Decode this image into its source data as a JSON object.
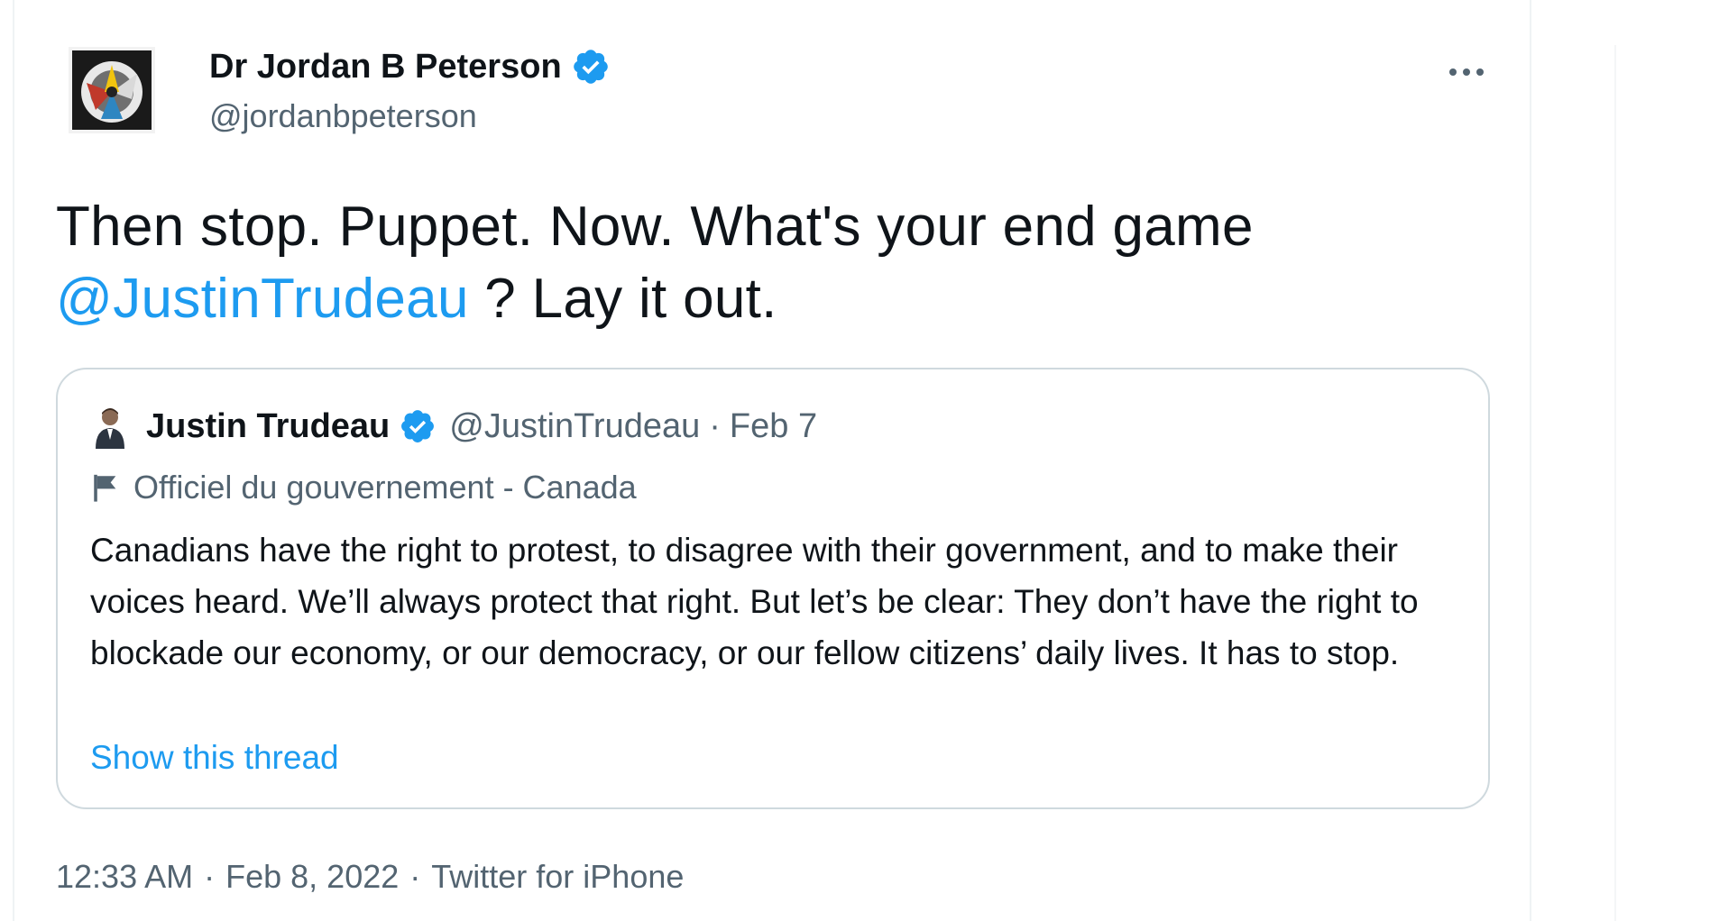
{
  "colors": {
    "accent": "#1d9bf0",
    "text": "#0f1419",
    "secondary": "#536471",
    "border": "#cfd9de"
  },
  "tweet": {
    "author_name": "Dr Jordan B Peterson",
    "author_handle": "@jordanbpeterson",
    "text_part1": "Then stop. Puppet. Now. What's your end game ",
    "mention": "@JustinTrudeau",
    "text_part2": " ? Lay it out.",
    "time": "12:33 AM",
    "date": "Feb 8, 2022",
    "source": "Twitter for iPhone",
    "separator": "·"
  },
  "quoted_tweet": {
    "author_name": "Justin Trudeau",
    "author_handle": "@JustinTrudeau",
    "separator": "·",
    "date": "Feb 7",
    "label": "Officiel du gouvernement - Canada",
    "text": "Canadians have the right to protest, to disagree with their government, and to make their voices heard. We’ll always protect that right. But let’s be clear: They don’t have the right to blockade our economy, or our democracy, or our fellow citizens’ daily lives. It has to stop.",
    "show_thread": "Show this thread"
  },
  "icons": {
    "verified": "verified-badge-icon",
    "more": "more-options-icon",
    "flag": "flag-icon"
  }
}
